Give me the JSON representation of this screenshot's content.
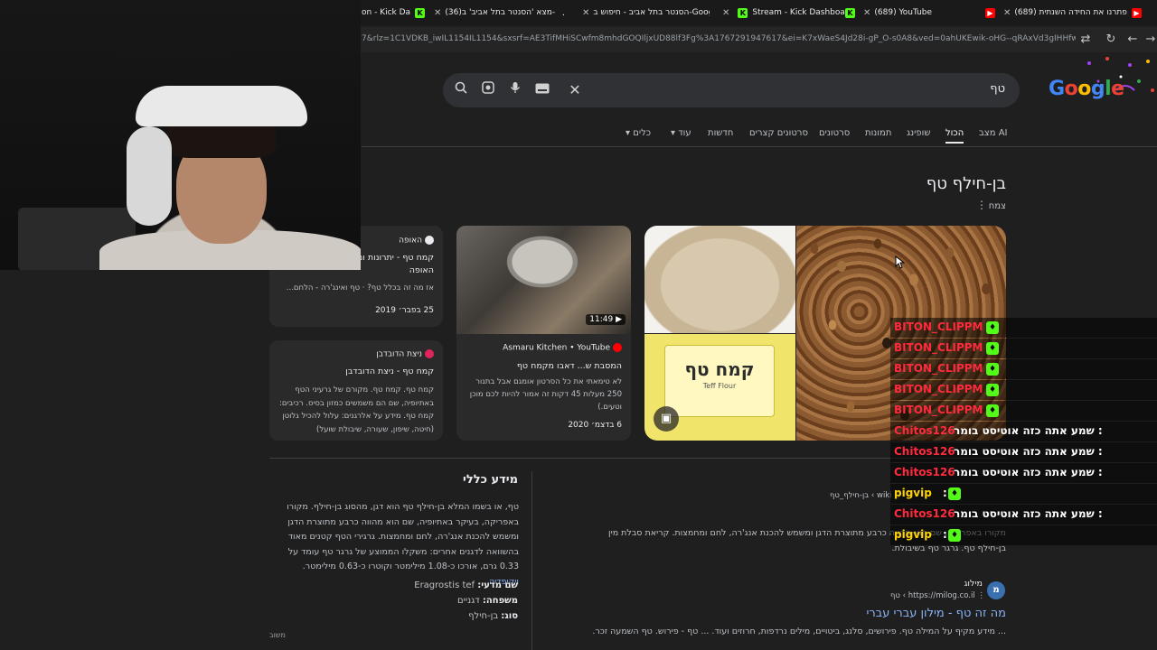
{
  "browser": {
    "tabs": [
      {
        "label": "on - Kick Da",
        "icon": "K",
        "icon_color": "#53fc18"
      },
      {
        "label": "(36)מצא 'הסנטר בתל אביב' ב-",
        "icon": "♪",
        "icon_color": "#111111"
      },
      {
        "label": "הסנטר בתל אביב - חיפוש ב-Google",
        "icon": "G",
        "icon_color": "#ffffff"
      },
      {
        "label": "Stream - Kick Dashboard",
        "icon": "K",
        "icon_color": "#53fc18"
      },
      {
        "label": "(689) YouTube",
        "icon": "▶",
        "icon_color": "#ff0000"
      },
      {
        "label": "(689) פתרנו את החידה השנתית",
        "icon": "▶",
        "icon_color": "#ff0000"
      }
    ],
    "url": "7&rlz=1C1VDKB_iwIL1154IL1154&sxsrf=AE3TifMHiSCwfm8mhdGOQIljxUD88lf3Fg%3A1767291947617&ei=K7xWaeS4Jd28i-gP_O-s0A8&ved=0ahUKEwik-oHG--qRAxVd3gIHHfw3C_oQ4dU..."
  },
  "search": {
    "logo": "Google",
    "query": "טף"
  },
  "tabs": [
    {
      "label": "מצב AI",
      "active": false
    },
    {
      "label": "הכול",
      "active": true
    },
    {
      "label": "שופינג",
      "active": false
    },
    {
      "label": "תמונות",
      "active": false
    },
    {
      "label": "סרטונים",
      "active": false
    },
    {
      "label": "סרטונים קצרים",
      "active": false
    },
    {
      "label": "חדשות",
      "active": false
    },
    {
      "label": "עוד",
      "active": false
    },
    {
      "label": "כלים",
      "active": false
    }
  ],
  "knowledge": {
    "title": "בן-חילף טף",
    "subtitle": "צמח",
    "pack_title": "קמח טף",
    "pack_subtitle": "Teff Flour",
    "video": {
      "duration": "11:49",
      "source": "Asmaru Kitchen • YouTube",
      "title": "המסבת ש... דאבו מקמח טף",
      "body": "לא טימאתי את כל הסרטון אומגם אבל בתנור 250 מעלות 45 דקות זה אמור להיות לכם מוכן וטעים.)",
      "date": "6 בדצמ׳ 2020"
    },
    "article1": {
      "source": "האופה",
      "title": "קמח טף - יתרונות ומה שחייבים לדעת - האופה",
      "body": "אז מה זה בכלל טף? · טף ואינג'רה - הלחם...",
      "date": "25 בפבר׳ 2019"
    },
    "article2": {
      "source": "ניצת הדובדבן",
      "title": "קמח טף - ניצת הדובדבן",
      "body": "קמח טף. קמח טף. מקורם של גרעיני הטף באתיופיה, שם הם משמשים כמזון בסיס. רכיבים: קמח טף. מידע על אלרגנים: עלול להכיל גלוטן (חיטה, שיפון, שעורה, שיבולת שועל)"
    }
  },
  "info": {
    "title": "מידע כללי",
    "body": "טף, או בשמו המלא בן-חילף טף הוא דגן, מהסוג בן-חילף. מקורו באפריקה, בעיקר באתיופיה, שם הוא מהווה כרבע מתוצרת הדגן ומשמש להכנת אנג'רה, לחם ומחמצות. גרגירי הטף קטנים מאוד בהשוואה לדגנים אחרים: משקלו הממוצע של גרגר טף עומד על 0.33 גרם, אורכו כ-1.08 מילימטר וקוטרו כ-0.63 מילימטר.",
    "wiki_link": "ויקיפדיה",
    "facts": [
      {
        "label": "שם מדעי:",
        "value": "Eragrostis tef"
      },
      {
        "label": "משפחה:",
        "value": "דגניים"
      },
      {
        "label": "סוג:",
        "value": "בן-חילף"
      }
    ],
    "feedback": "משוב"
  },
  "results": {
    "wiki_url": "wiki › בן-חילף_טף",
    "wiki_body": "מקורו באפריקה, שם הוא מהווה כרבע מתוצרת הדגן ומשמש להכנת אנג'רה, לחם ומחמצות. קריאת סבלת מין בן-חילף טף. גרגר טף בשיבולת.",
    "milog_site": "מילוג",
    "milog_url": "https://milog.co.il › טף",
    "milog_title": "מה זה טף - מילון עברי עברי",
    "milog_snippet": "... מידע מקיף על המילה טף. פירושים, סלנג, ביטויים, מילים נרדפות, חרוזים ועוד. ... טף - פירוש. טף השמעה זכר."
  },
  "chat": [
    {
      "user": "BITON_CLIPPM",
      "message": "",
      "color": "#ff2a3d"
    },
    {
      "user": "BITON_CLIPPM",
      "message": "",
      "color": "#ff2a3d"
    },
    {
      "user": "BITON_CLIPPM",
      "message": "",
      "color": "#ff2a3d"
    },
    {
      "user": "BITON_CLIPPM",
      "message": "",
      "color": "#ff2a3d"
    },
    {
      "user": "BITON_CLIPPM",
      "message": "",
      "color": "#ff2a3d"
    },
    {
      "user": "Chitos126",
      "message": ": שמע אתה כזה אוטיסט בומר",
      "color": "#ff2a3d"
    },
    {
      "user": "Chitos126",
      "message": ": שמע אתה כזה אוטיסט בומר",
      "color": "#ff2a3d"
    },
    {
      "user": "Chitos126",
      "message": ": שמע אתה כזה אוטיסט בומר",
      "color": "#ff2a3d"
    },
    {
      "user": "pigvip",
      "message": ":",
      "color": "#ffd400"
    },
    {
      "user": "Chitos126",
      "message": ": שמע אתה כזה אוטיסט בומר",
      "color": "#ff2a3d"
    },
    {
      "user": "pigvip",
      "message": ":",
      "color": "#ffd400"
    }
  ]
}
